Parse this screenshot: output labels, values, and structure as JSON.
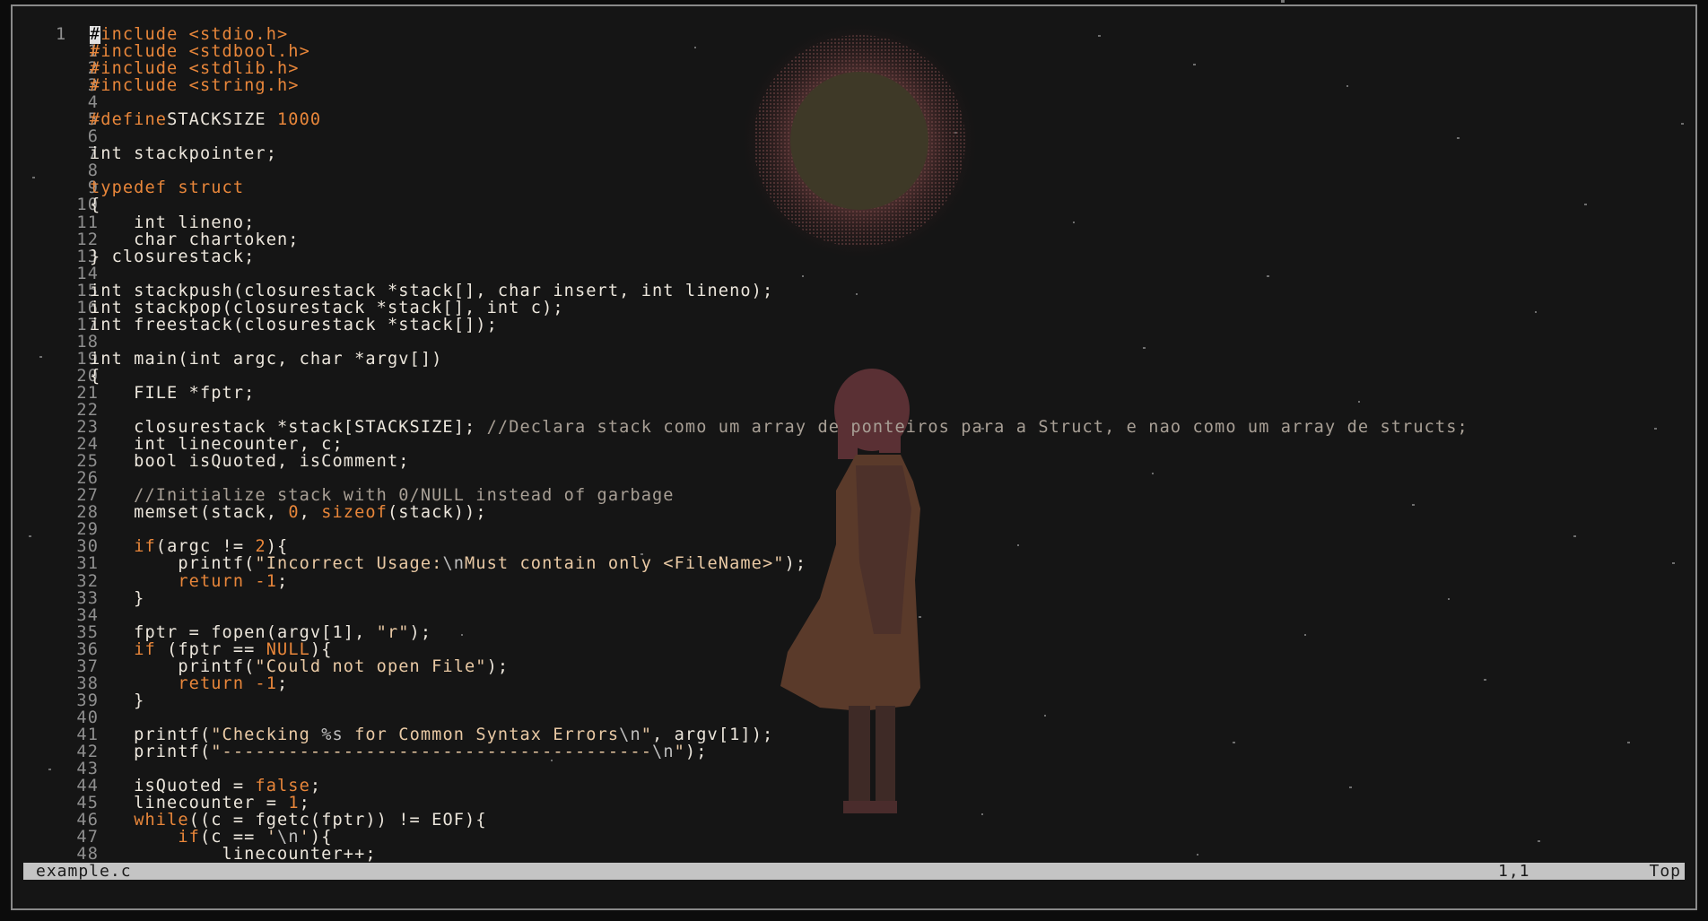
{
  "editor": {
    "cursor_char": "#",
    "lines": [
      {
        "n": "1",
        "first": true,
        "segs": [
          [
            "pp",
            "include <stdio.h>"
          ]
        ]
      },
      {
        "n": "1",
        "segs": [
          [
            "pp",
            "#include <stdbool.h>"
          ]
        ]
      },
      {
        "n": "2",
        "segs": [
          [
            "pp",
            "#include <stdlib.h>"
          ]
        ]
      },
      {
        "n": "3",
        "segs": [
          [
            "pp",
            "#include <string.h>"
          ]
        ]
      },
      {
        "n": "4",
        "segs": []
      },
      {
        "n": "5",
        "segs": [
          [
            "pp",
            "#define"
          ],
          [
            "",
            "STACKSIZE "
          ],
          [
            "num",
            "1000"
          ]
        ]
      },
      {
        "n": "6",
        "segs": []
      },
      {
        "n": "7",
        "segs": [
          [
            "",
            "int stackpointer;"
          ]
        ]
      },
      {
        "n": "8",
        "segs": []
      },
      {
        "n": "9",
        "segs": [
          [
            "kw",
            "typedef struct"
          ]
        ]
      },
      {
        "n": "10",
        "segs": [
          [
            "",
            "{"
          ]
        ]
      },
      {
        "n": "11",
        "segs": [
          [
            "",
            "    int lineno;"
          ]
        ]
      },
      {
        "n": "12",
        "segs": [
          [
            "",
            "    char chartoken;"
          ]
        ]
      },
      {
        "n": "13",
        "segs": [
          [
            "",
            "} closurestack;"
          ]
        ]
      },
      {
        "n": "14",
        "segs": []
      },
      {
        "n": "15",
        "segs": [
          [
            "",
            "int stackpush(closurestack *stack[], char insert, int lineno);"
          ]
        ]
      },
      {
        "n": "16",
        "segs": [
          [
            "",
            "int stackpop(closurestack *stack[], int c);"
          ]
        ]
      },
      {
        "n": "17",
        "segs": [
          [
            "",
            "int freestack(closurestack *stack[]);"
          ]
        ]
      },
      {
        "n": "18",
        "segs": []
      },
      {
        "n": "19",
        "segs": [
          [
            "",
            "int main(int argc, char *argv[])"
          ]
        ]
      },
      {
        "n": "20",
        "segs": [
          [
            "",
            "{"
          ]
        ]
      },
      {
        "n": "21",
        "segs": [
          [
            "",
            "    FILE *fptr;"
          ]
        ]
      },
      {
        "n": "22",
        "segs": []
      },
      {
        "n": "23",
        "segs": [
          [
            "",
            "    closurestack *stack[STACKSIZE]; "
          ],
          [
            "cmt",
            "//Declara stack como um array de ponteiros para a Struct, e nao como um array de structs;"
          ]
        ]
      },
      {
        "n": "24",
        "segs": [
          [
            "",
            "    int linecounter, c;"
          ]
        ]
      },
      {
        "n": "25",
        "segs": [
          [
            "",
            "    bool isQuoted, isComment;"
          ]
        ]
      },
      {
        "n": "26",
        "segs": []
      },
      {
        "n": "27",
        "segs": [
          [
            "cmt",
            "    //Initialize stack with 0/NULL instead of garbage"
          ]
        ]
      },
      {
        "n": "28",
        "segs": [
          [
            "",
            "    memset(stack, "
          ],
          [
            "num",
            "0"
          ],
          [
            "",
            ", "
          ],
          [
            "kw",
            "sizeof"
          ],
          [
            "",
            "(stack));"
          ]
        ]
      },
      {
        "n": "29",
        "segs": []
      },
      {
        "n": "30",
        "segs": [
          [
            "",
            "    "
          ],
          [
            "kw",
            "if"
          ],
          [
            "",
            "(argc != "
          ],
          [
            "num",
            "2"
          ],
          [
            "",
            "){"
          ]
        ]
      },
      {
        "n": "31",
        "segs": [
          [
            "",
            "        printf("
          ],
          [
            "str",
            "\"Incorrect Usage:"
          ],
          [
            "esc",
            "\\n"
          ],
          [
            "str",
            "Must contain only <FileName>\""
          ],
          [
            "",
            ");"
          ]
        ]
      },
      {
        "n": "32",
        "segs": [
          [
            "",
            "        "
          ],
          [
            "kw",
            "return"
          ],
          [
            "num",
            " -1"
          ],
          [
            "",
            ";"
          ]
        ]
      },
      {
        "n": "33",
        "segs": [
          [
            "",
            "    }"
          ]
        ]
      },
      {
        "n": "34",
        "segs": []
      },
      {
        "n": "35",
        "segs": [
          [
            "",
            "    fptr = fopen(argv[1], "
          ],
          [
            "str",
            "\"r\""
          ],
          [
            "",
            ");"
          ]
        ]
      },
      {
        "n": "36",
        "segs": [
          [
            "",
            "    "
          ],
          [
            "kw",
            "if"
          ],
          [
            "",
            " (fptr == "
          ],
          [
            "num",
            "NULL"
          ],
          [
            "",
            "){"
          ]
        ]
      },
      {
        "n": "37",
        "segs": [
          [
            "",
            "        printf("
          ],
          [
            "str",
            "\"Could not open File\""
          ],
          [
            "",
            ");"
          ]
        ]
      },
      {
        "n": "38",
        "segs": [
          [
            "",
            "        "
          ],
          [
            "kw",
            "return"
          ],
          [
            "num",
            " -1"
          ],
          [
            "",
            ";"
          ]
        ]
      },
      {
        "n": "39",
        "segs": [
          [
            "",
            "    }"
          ]
        ]
      },
      {
        "n": "40",
        "segs": []
      },
      {
        "n": "41",
        "segs": [
          [
            "",
            "    printf("
          ],
          [
            "str",
            "\"Checking "
          ],
          [
            "esc",
            "%s"
          ],
          [
            "str",
            " for Common Syntax Errors"
          ],
          [
            "esc",
            "\\n"
          ],
          [
            "str",
            "\""
          ],
          [
            "",
            ", argv[1]);"
          ]
        ]
      },
      {
        "n": "42",
        "segs": [
          [
            "",
            "    printf("
          ],
          [
            "str",
            "\"---------------------------------------"
          ],
          [
            "esc",
            "\\n"
          ],
          [
            "str",
            "\""
          ],
          [
            "",
            ");"
          ]
        ]
      },
      {
        "n": "43",
        "segs": []
      },
      {
        "n": "44",
        "segs": [
          [
            "",
            "    isQuoted = "
          ],
          [
            "num",
            "false"
          ],
          [
            "",
            ";"
          ]
        ]
      },
      {
        "n": "45",
        "segs": [
          [
            "",
            "    linecounter = "
          ],
          [
            "num",
            "1"
          ],
          [
            "",
            ";"
          ]
        ]
      },
      {
        "n": "46",
        "segs": [
          [
            "",
            "    "
          ],
          [
            "kw",
            "while"
          ],
          [
            "",
            "((c = fgetc(fptr)) != EOF){"
          ]
        ]
      },
      {
        "n": "47",
        "segs": [
          [
            "",
            "        "
          ],
          [
            "kw",
            "if"
          ],
          [
            "",
            "(c == "
          ],
          [
            "str",
            "'"
          ],
          [
            "esc",
            "\\n"
          ],
          [
            "str",
            "'"
          ],
          [
            "",
            "){"
          ]
        ]
      },
      {
        "n": "48",
        "segs": [
          [
            "",
            "            linecounter++;"
          ]
        ]
      }
    ]
  },
  "status": {
    "filename": "example.c",
    "position": "1,1",
    "scroll": "Top"
  },
  "colors": {
    "keyword": "#e8863a",
    "string": "#e9c9a4",
    "comment": "#a89f95",
    "text": "#ece6dc",
    "status_bg": "#c4c4c4"
  }
}
